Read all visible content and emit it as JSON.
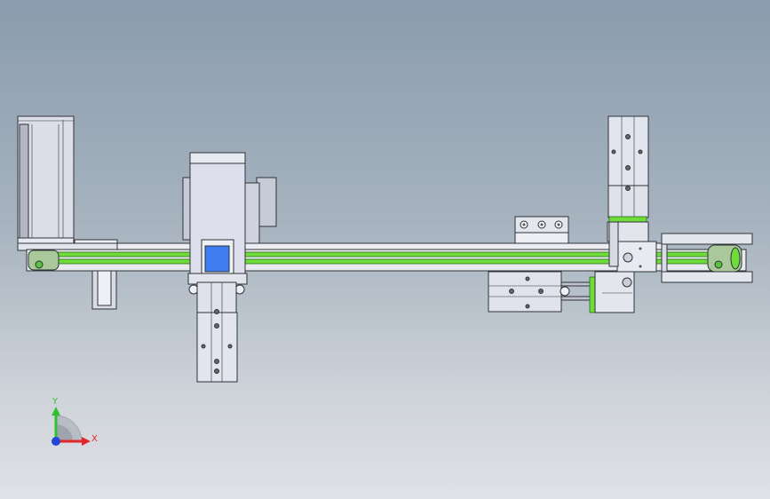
{
  "viewport": {
    "background_top": "#8a9cad",
    "background_bottom": "#dfe2e6"
  },
  "model": {
    "belt_color": "#6fdc3c",
    "metal_color": "#d9dbe8",
    "carriage_window_color": "#3f7df2"
  },
  "triad": {
    "y_label": "Y",
    "x_label": "X",
    "y_color": "#2fc22f",
    "x_color": "#e3262a",
    "z_color": "#2346d6"
  }
}
